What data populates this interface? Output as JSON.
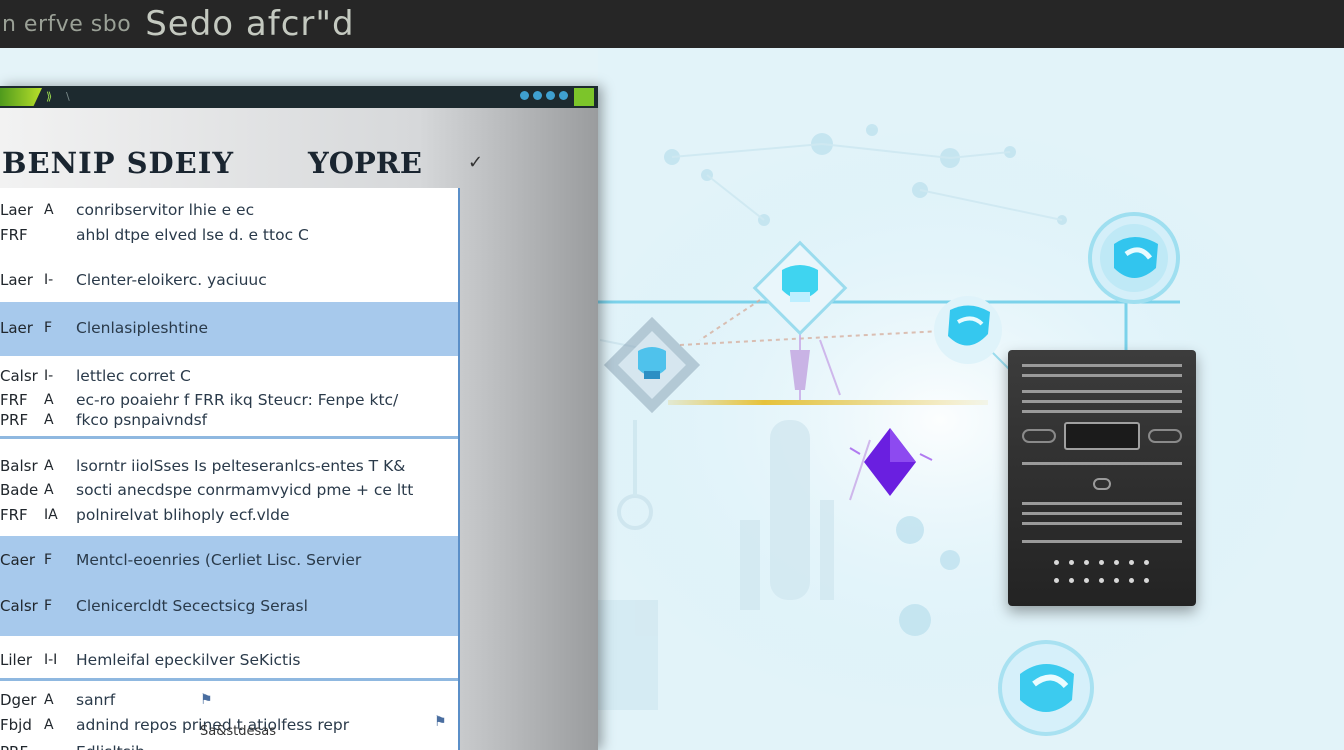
{
  "topbar": {
    "subtitle": "n erfve sbo",
    "title": "Sedo afcr\"d"
  },
  "window": {
    "title_glyph": "⟫",
    "title_glyph_right": "\\ ",
    "heading_left": "BENIP SDEIY",
    "heading_right": "YOPRE",
    "rows": [
      {
        "c1": "Laer",
        "c2": "A",
        "text": "conribservitor lhie e ec",
        "highlight": false
      },
      {
        "c1": "FRF",
        "c2": "",
        "text": "ahbl dtpe elved lse d. e ttoc C",
        "highlight": false
      },
      {
        "c1": "Laer",
        "c2": "I-",
        "text": "Clenter-eloikerc. yaciuuc",
        "highlight": false
      },
      {
        "c1": "Laer",
        "c2": "F",
        "text": "Clenlasipleshtine",
        "highlight": true
      },
      {
        "c1": "Calsr",
        "c2": "I-",
        "text": "lettlec corret C",
        "highlight": false
      },
      {
        "c1": "FRF",
        "c2": "A",
        "text": "ec-ro poaiehr f FRR ikq  Steucr: Fenpe ktc/",
        "highlight": false
      },
      {
        "c1": "PRF",
        "c2": "A",
        "text": "fkco psnpaivndsf",
        "highlight": false
      },
      {
        "c1": "Balsr",
        "c2": "A",
        "text": "lsorntr iiolSses Is pelteseranlcs-entes T K&",
        "highlight": false
      },
      {
        "c1": "Bade",
        "c2": "A",
        "text": "socti anecdspe conrmamvyicd pme + ce ltt",
        "highlight": false
      },
      {
        "c1": "FRF",
        "c2": "IA",
        "text": "polnirelvat blihoply ecf.vlde",
        "highlight": false
      },
      {
        "c1": "Caer",
        "c2": "F",
        "text": "Mentcl-eoenries (Cerliet Lisc. Servier",
        "highlight": true
      },
      {
        "c1": "Calsr",
        "c2": "F",
        "text": "Clenicercldt Secectsicg Serasl",
        "highlight": true
      },
      {
        "c1": "Liler",
        "c2": "I-I",
        "text": "Hemleifal epeckilver SeKictis",
        "highlight": false
      },
      {
        "c1": "Dger",
        "c2": "A",
        "text": "sanrf",
        "highlight": false
      },
      {
        "c1": "Fbjd",
        "c2": "A",
        "text": "adnind repos prined t atiolfess repr",
        "highlight": false
      },
      {
        "c1": "PRF",
        "c2": "",
        "text": "Edlisltsib",
        "highlight": false
      }
    ],
    "footer_fragment": "Sa&stdesas"
  },
  "colors": {
    "accent_blue": "#a7c9ec",
    "topbar_bg": "#262626",
    "server_body": "#2a2a2a",
    "node_cyan": "#4fd3f0",
    "node_purple": "#7a2fe0",
    "beam_yellow": "#e6c23a"
  },
  "icons": {
    "shield_a": "shield-icon",
    "shield_b": "shield-icon",
    "shield_c": "shield-icon",
    "shield_d": "shield-icon",
    "shield_e": "shield-icon",
    "diamond": "diamond-icon",
    "server": "server-icon"
  }
}
